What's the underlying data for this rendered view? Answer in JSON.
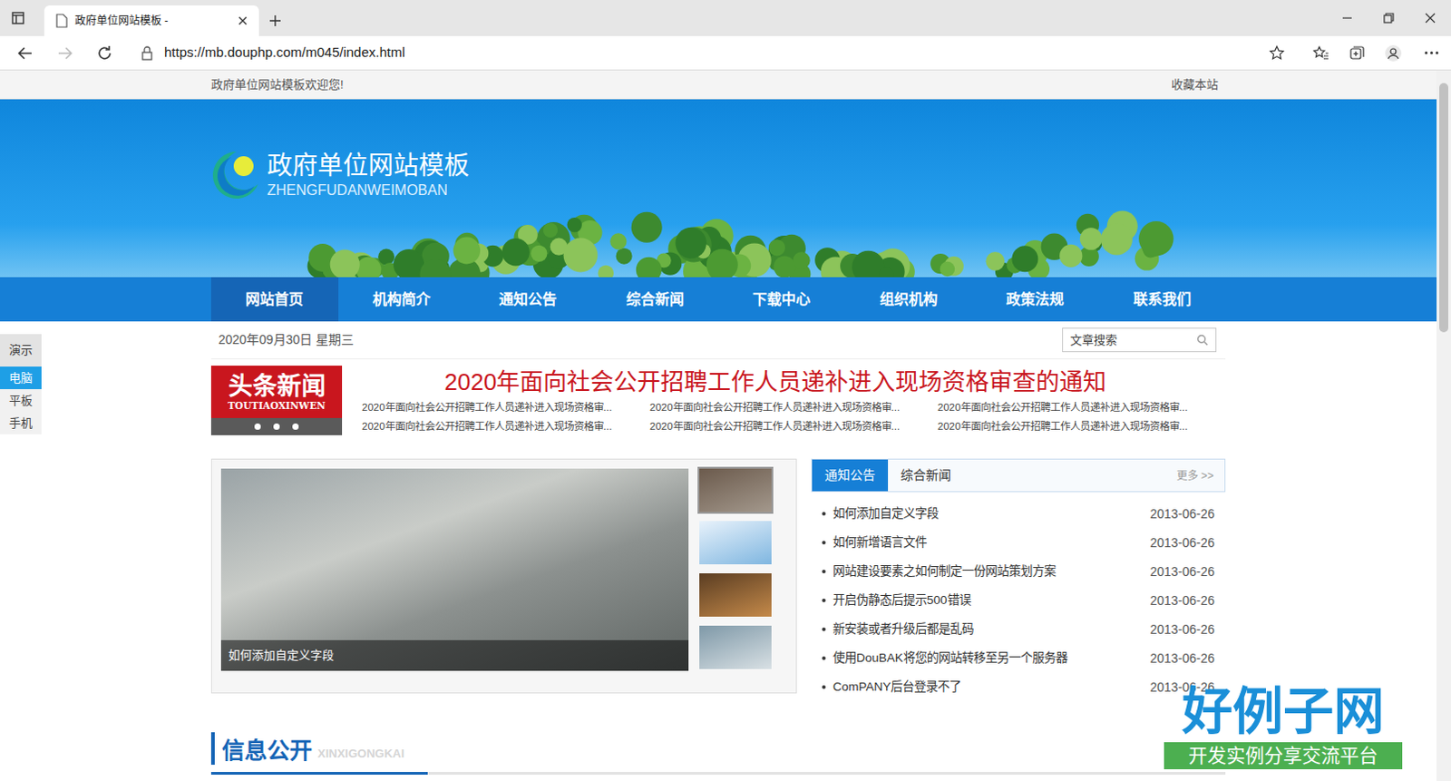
{
  "browser": {
    "tab_title": "政府单位网站模板 -",
    "url": "https://mb.douphp.com/m045/index.html"
  },
  "topbar": {
    "welcome": "政府单位网站模板欢迎您!",
    "bookmark": "收藏本站"
  },
  "logo": {
    "title": "政府单位网站模板",
    "subtitle": "ZHENGFUDANWEIMOBAN"
  },
  "nav": [
    {
      "label": "网站首页",
      "selected": true
    },
    {
      "label": "机构简介",
      "selected": false
    },
    {
      "label": "通知公告",
      "selected": false
    },
    {
      "label": "综合新闻",
      "selected": false
    },
    {
      "label": "下载中心",
      "selected": false
    },
    {
      "label": "组织机构",
      "selected": false
    },
    {
      "label": "政策法规",
      "selected": false
    },
    {
      "label": "联系我们",
      "selected": false
    }
  ],
  "date": "2020年09月30日 星期三",
  "search": {
    "placeholder": "文章搜索"
  },
  "headline": {
    "badge": "头条新闻",
    "badge_sub": "TOUTIAOXINWEN",
    "title": "2020年面向社会公开招聘工作人员递补进入现场资格审查的通知",
    "links": [
      "2020年面向社会公开招聘工作人员递补进入现场资格审...",
      "2020年面向社会公开招聘工作人员递补进入现场资格审...",
      "2020年面向社会公开招聘工作人员递补进入现场资格审...",
      "2020年面向社会公开招聘工作人员递补进入现场资格审...",
      "2020年面向社会公开招聘工作人员递补进入现场资格审...",
      "2020年面向社会公开招聘工作人员递补进入现场资格审..."
    ]
  },
  "slider": {
    "caption": "如何添加自定义字段",
    "thumbs": [
      {
        "selected": true
      },
      {
        "selected": false
      },
      {
        "selected": false
      },
      {
        "selected": false
      }
    ]
  },
  "news_tabs": [
    {
      "label": "通知公告",
      "selected": true
    },
    {
      "label": "综合新闻",
      "selected": false
    }
  ],
  "more": "更多 >>",
  "news": [
    {
      "title": "如何添加自定义字段",
      "date": "2013-06-26"
    },
    {
      "title": "如何新增语言文件",
      "date": "2013-06-26"
    },
    {
      "title": "网站建设要素之如何制定一份网站策划方案",
      "date": "2013-06-26"
    },
    {
      "title": "开启伪静态后提示500错误",
      "date": "2013-06-26"
    },
    {
      "title": "新安装或者升级后都是乱码",
      "date": "2013-06-26"
    },
    {
      "title": "使用DouBAK将您的网站转移至另一个服务器",
      "date": "2013-06-26"
    },
    {
      "title": "ComPANY后台登录不了",
      "date": "2013-06-26"
    }
  ],
  "section": {
    "title": "信息公开",
    "subtitle": "XINXIGONGKAI"
  },
  "device_panel": {
    "title": "演示",
    "items": [
      {
        "label": "电脑",
        "selected": true
      },
      {
        "label": "平板",
        "selected": false
      },
      {
        "label": "手机",
        "selected": false
      }
    ]
  },
  "watermark": {
    "title": "好例子网",
    "subtitle": "开发实例分享交流平台"
  }
}
